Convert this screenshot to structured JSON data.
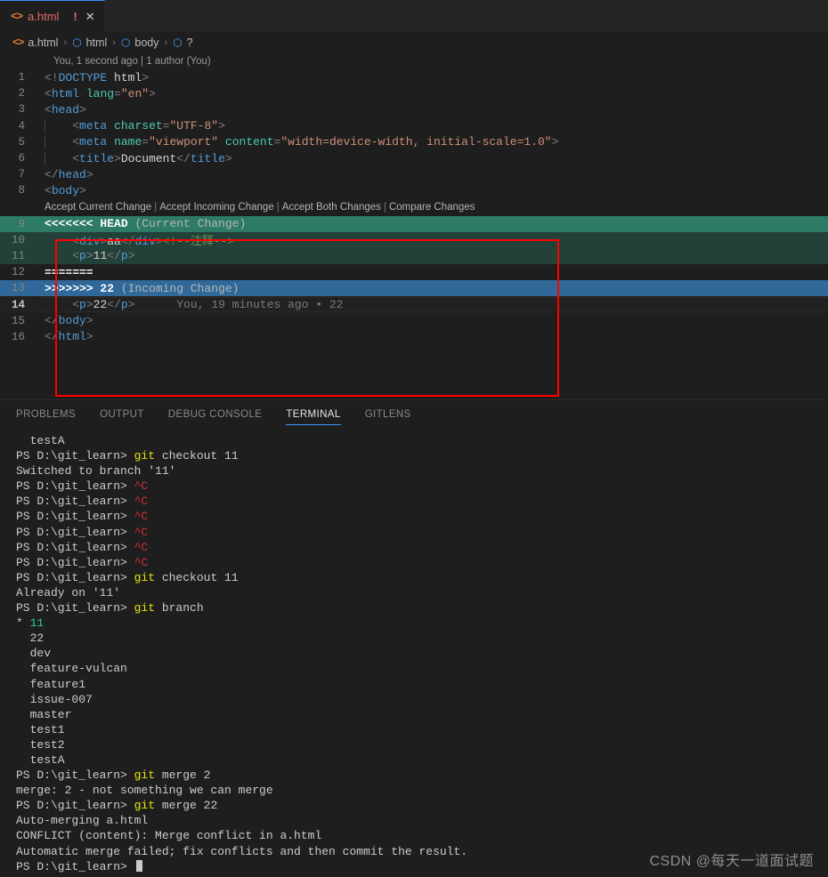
{
  "window": {
    "title": "a.html"
  },
  "tab": {
    "icon": "html-file-icon",
    "label": "a.html",
    "warning_glyph": "!",
    "close_glyph": "✕"
  },
  "breadcrumb": {
    "items": [
      "a.html",
      "html",
      "body",
      "?"
    ],
    "separator": "›",
    "symbol_glyph": "⬡"
  },
  "editor": {
    "top_codelens": "You, 1 second ago | 1 author (You)",
    "conflict_actions": [
      "Accept Current Change",
      "Accept Incoming Change",
      "Accept Both Changes",
      "Compare Changes"
    ],
    "action_separator": "|",
    "lines": [
      {
        "n": "1",
        "text": "<!DOCTYPE html>"
      },
      {
        "n": "2",
        "text": "<html lang=\"en\">"
      },
      {
        "n": "3",
        "text": "<head>"
      },
      {
        "n": "4",
        "text": "    <meta charset=\"UTF-8\">"
      },
      {
        "n": "5",
        "text": "    <meta name=\"viewport\" content=\"width=device-width, initial-scale=1.0\">"
      },
      {
        "n": "6",
        "text": "    <title>Document</title>"
      },
      {
        "n": "7",
        "text": "</head>"
      },
      {
        "n": "8",
        "text": "<body>"
      },
      {
        "n": "9",
        "text": "<<<<<<< HEAD (Current Change)"
      },
      {
        "n": "10",
        "text": "    <div>aa</div><!--注释-->"
      },
      {
        "n": "11",
        "text": "    <p>11</p>"
      },
      {
        "n": "12",
        "text": "======="
      },
      {
        "n": "13",
        "text": ">>>>>>> 22 (Incoming Change)"
      },
      {
        "n": "14",
        "text": "    <p>22</p>"
      },
      {
        "n": "15",
        "text": "</body>"
      },
      {
        "n": "16",
        "text": "</html>"
      }
    ],
    "line14_blame": "You, 19 minutes ago • 22",
    "conflict_current_marker": "<<<<<<< HEAD",
    "conflict_current_label": "(Current Change)",
    "conflict_divider": "=======",
    "conflict_incoming_marker": ">>>>>>> 22",
    "conflict_incoming_label": "(Incoming Change)",
    "active_line": "14"
  },
  "panel": {
    "tabs": [
      {
        "label": "PROBLEMS",
        "active": false
      },
      {
        "label": "OUTPUT",
        "active": false
      },
      {
        "label": "DEBUG CONSOLE",
        "active": false
      },
      {
        "label": "TERMINAL",
        "active": true
      },
      {
        "label": "GITLENS",
        "active": false
      }
    ]
  },
  "terminal": {
    "prompt": "PS D:\\git_learn>",
    "lines": [
      {
        "type": "plain",
        "text": "  testA"
      },
      {
        "type": "prompt",
        "cmd": "git",
        "rest": " checkout 11"
      },
      {
        "type": "plain",
        "text": "Switched to branch '11'"
      },
      {
        "type": "ctrlc",
        "text": "^C"
      },
      {
        "type": "ctrlc",
        "text": "^C"
      },
      {
        "type": "ctrlc",
        "text": "^C"
      },
      {
        "type": "ctrlc",
        "text": "^C"
      },
      {
        "type": "ctrlc",
        "text": "^C"
      },
      {
        "type": "ctrlc",
        "text": "^C"
      },
      {
        "type": "prompt",
        "cmd": "git",
        "rest": " checkout 11"
      },
      {
        "type": "plain",
        "text": "Already on '11'"
      },
      {
        "type": "prompt",
        "cmd": "git",
        "rest": " branch"
      },
      {
        "type": "branch-current",
        "text": "* 11"
      },
      {
        "type": "plain",
        "text": "  22"
      },
      {
        "type": "plain",
        "text": "  dev"
      },
      {
        "type": "plain",
        "text": "  feature-vulcan"
      },
      {
        "type": "plain",
        "text": "  feature1"
      },
      {
        "type": "plain",
        "text": "  issue-007"
      },
      {
        "type": "plain",
        "text": "  master"
      },
      {
        "type": "plain",
        "text": "  test1"
      },
      {
        "type": "plain",
        "text": "  test2"
      },
      {
        "type": "plain",
        "text": "  testA"
      },
      {
        "type": "prompt",
        "cmd": "git",
        "rest": " merge 2"
      },
      {
        "type": "plain",
        "text": "merge: 2 - not something we can merge"
      },
      {
        "type": "prompt",
        "cmd": "git",
        "rest": " merge 22"
      },
      {
        "type": "plain",
        "text": "Auto-merging a.html"
      },
      {
        "type": "plain",
        "text": "CONFLICT (content): Merge conflict in a.html"
      },
      {
        "type": "plain",
        "text": "Automatic merge failed; fix conflicts and then commit the result."
      },
      {
        "type": "cursor",
        "text": ""
      }
    ]
  },
  "watermark": "CSDN @每天一道面试题",
  "colors": {
    "current_change_header": "#2d7a66",
    "current_change_body": "#234039",
    "incoming_change_header": "#2f6899",
    "annotation_box": "#ff0000",
    "accent": "#3794ff",
    "editor_bg": "#1e1e1e"
  }
}
